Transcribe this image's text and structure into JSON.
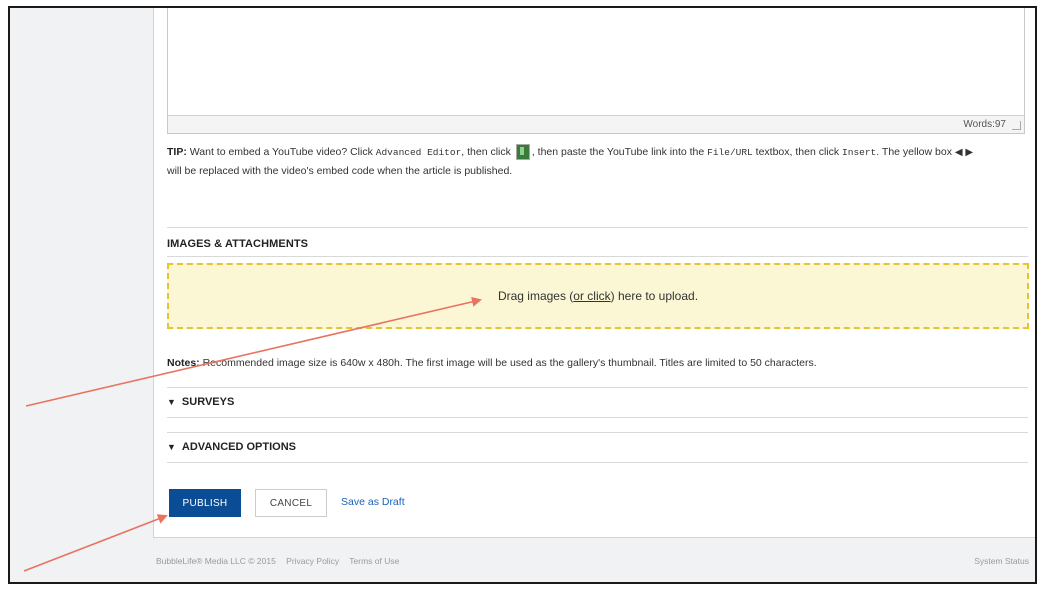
{
  "editor": {
    "word_count": "Words:97"
  },
  "tip": {
    "label": "TIP:",
    "text_1": " Want to embed a YouTube video? Click ",
    "advanced_editor": "Advanced Editor",
    "text_2": ", then click ",
    "text_3": ", then paste the YouTube link into the ",
    "file_url": "File/URL",
    "text_4": " textbox, then click ",
    "insert": "Insert",
    "text_5": ". The yellow box",
    "arrows": "◀ ▶",
    "text_6": "will be replaced with the video's embed code when the article is published."
  },
  "images": {
    "title": "IMAGES & ATTACHMENTS",
    "drop_before": "Drag images (",
    "drop_link": "or click",
    "drop_after": ") here to upload."
  },
  "notes": {
    "label": "Notes:",
    "text": " Recommended image size is 640w x 480h. The first image will be used as the gallery's thumbnail. Titles are limited to 50 characters."
  },
  "sections": {
    "surveys": "SURVEYS",
    "advanced": "ADVANCED OPTIONS"
  },
  "actions": {
    "publish": "PUBLISH",
    "cancel": "CANCEL",
    "draft": "Save as Draft"
  },
  "footer": {
    "copyright": "BubbleLife® Media LLC © 2015",
    "privacy": "Privacy Policy",
    "terms": "Terms of Use",
    "status": "System Status"
  },
  "colors": {
    "publish_bg": "#0b4d95",
    "dropzone_bg": "#fbf6d4",
    "dropzone_border": "#e4c431",
    "annotation_arrow": "#e8735f",
    "link": "#1a62b8"
  }
}
